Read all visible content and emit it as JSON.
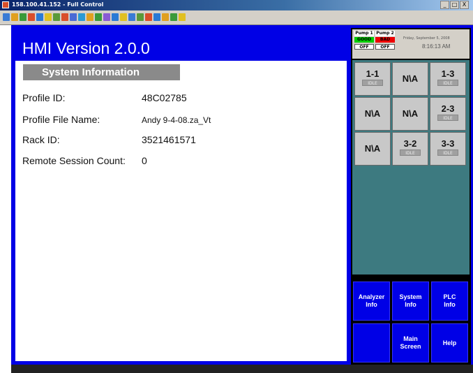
{
  "window": {
    "title": "158.100.41.152 - Full Control",
    "buttons": [
      "_",
      "□",
      "X"
    ]
  },
  "toolbar": {
    "icon_colors": [
      "#3a7bd5",
      "#e0a020",
      "#3a9a3a",
      "#d94f2a",
      "#2a7ad5",
      "#e0c020",
      "#5a9a3a",
      "#d94f2a",
      "#4a6ad5",
      "#2a9ad5",
      "#e0a020",
      "#3a9a3a",
      "#8a5ad5",
      "#2a7ad5",
      "#e0c020",
      "#3a7bd5",
      "#5a9a3a",
      "#d94f2a",
      "#2a7ad5",
      "#e0a020",
      "#3a9a3a",
      "#e0c020"
    ]
  },
  "header": {
    "title": "HMI Version 2.0.0"
  },
  "system_info": {
    "heading": "System Information",
    "rows": [
      {
        "label": "Profile ID:",
        "value": "48C02785"
      },
      {
        "label": "Profile File Name:",
        "value": "Andy 9-4-08.za_Vt"
      },
      {
        "label": "Rack ID:",
        "value": "3521461571"
      },
      {
        "label": "Remote Session Count:",
        "value": "0"
      }
    ]
  },
  "pumps": [
    {
      "label": "Pump 1",
      "status": "GOOD",
      "status_color": "#00cc00",
      "state": "OFF"
    },
    {
      "label": "Pump 2",
      "status": "BAD",
      "status_color": "#ee0000",
      "state": "OFF"
    }
  ],
  "datetime": {
    "date": "Friday, September 5, 2008",
    "time": "8:16:13 AM"
  },
  "analyzers": {
    "cells": [
      {
        "id": "1-1",
        "status": "IDLE"
      },
      {
        "id": "N\\A",
        "status": ""
      },
      {
        "id": "1-3",
        "status": "IDLE"
      },
      {
        "id": "N\\A",
        "status": ""
      },
      {
        "id": "N\\A",
        "status": ""
      },
      {
        "id": "2-3",
        "status": "IDLE"
      },
      {
        "id": "N\\A",
        "status": ""
      },
      {
        "id": "3-2",
        "status": "IDLE"
      },
      {
        "id": "3-3",
        "status": "IDLE"
      }
    ]
  },
  "nav": {
    "analyzer_info": "Analyzer\nInfo",
    "system_info": "System\nInfo",
    "plc_info": "PLC\nInfo",
    "blank": "",
    "main_screen": "Main\nScreen",
    "help": "Help"
  }
}
